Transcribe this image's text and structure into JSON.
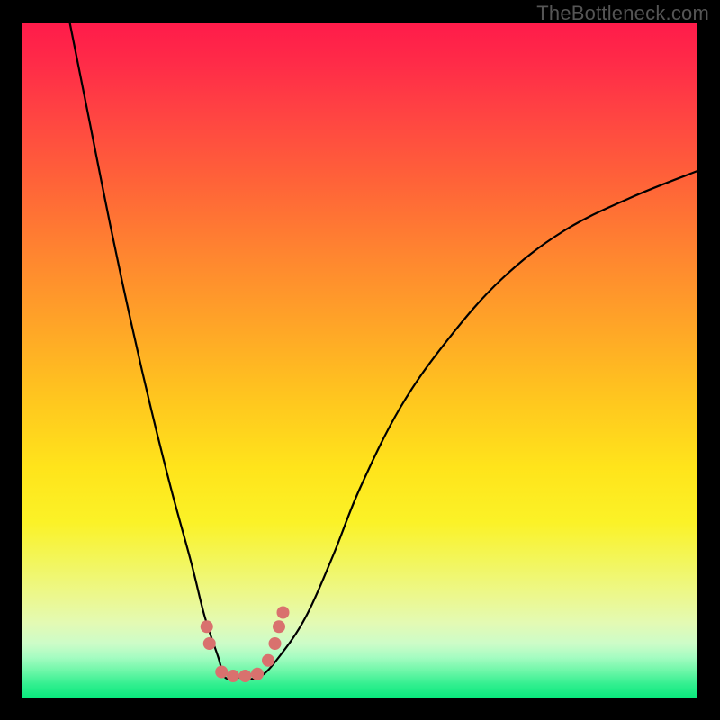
{
  "watermark": "TheBottleneck.com",
  "chart_data": {
    "type": "line",
    "title": "",
    "xlabel": "",
    "ylabel": "",
    "xlim": [
      0,
      100
    ],
    "ylim": [
      0,
      100
    ],
    "grid": false,
    "note": "V-shaped bottleneck curve over a vertical performance gradient (red=high bottleneck at top, green=low at bottom). Axes unlabeled; values are relative positions read from the image.",
    "series": [
      {
        "name": "bottleneck-curve",
        "color": "#000000",
        "x": [
          7,
          10,
          13,
          16,
          19,
          22,
          25,
          27,
          29,
          30,
          32,
          35,
          38,
          42,
          46,
          50,
          56,
          63,
          71,
          80,
          90,
          100
        ],
        "y": [
          100,
          85,
          70,
          56,
          43,
          31,
          20,
          12,
          6,
          3,
          3,
          3,
          6,
          12,
          21,
          31,
          43,
          53,
          62,
          69,
          74,
          78
        ]
      }
    ],
    "markers": {
      "name": "highlight-dots",
      "color": "#d9716e",
      "radius_px": 7,
      "x": [
        27.3,
        27.7,
        29.5,
        31.2,
        33.0,
        34.8,
        36.4,
        37.4,
        38.0,
        38.6
      ],
      "y": [
        10.5,
        8.0,
        3.8,
        3.2,
        3.2,
        3.5,
        5.5,
        8.0,
        10.5,
        12.6
      ]
    },
    "gradient_axis": {
      "orientation": "vertical",
      "top_meaning": "high bottleneck",
      "bottom_meaning": "low bottleneck",
      "stops": [
        {
          "pos": 0.0,
          "color": "#ff1b4a"
        },
        {
          "pos": 0.24,
          "color": "#ff6438"
        },
        {
          "pos": 0.55,
          "color": "#ffc41f"
        },
        {
          "pos": 0.8,
          "color": "#f2f65e"
        },
        {
          "pos": 0.92,
          "color": "#cdfcc8"
        },
        {
          "pos": 1.0,
          "color": "#0ae97d"
        }
      ]
    }
  }
}
